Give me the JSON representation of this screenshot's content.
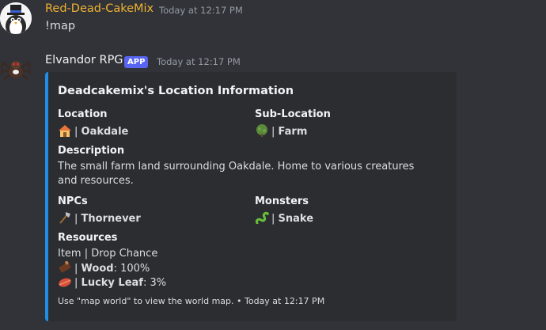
{
  "messages": [
    {
      "author": "Red-Dead-CakeMix",
      "author_color": "#f0b232",
      "timestamp": "Today at 12:17 PM",
      "text": "!map"
    },
    {
      "author": "Elvandor RPG",
      "author_color": "#f2f3f5",
      "badge": "APP",
      "timestamp": "Today at 12:17 PM"
    }
  ],
  "embed": {
    "accent_color": "#1e8ee6",
    "title": "Deadcakemix's Location Information",
    "location": {
      "name": "Location",
      "icon": "house-emoji",
      "separator": "|",
      "value": "Oakdale"
    },
    "sublocation": {
      "name": "Sub-Location",
      "icon": "tree-emoji",
      "separator": "|",
      "value": "Farm"
    },
    "description": {
      "name": "Description",
      "value": "The small farm land surrounding Oakdale. Home to various creatures and resources."
    },
    "npcs": {
      "name": "NPCs",
      "icon": "axe-emoji",
      "separator": "|",
      "value": "Thornever"
    },
    "monsters": {
      "name": "Monsters",
      "icon": "snake-emoji",
      "separator": "|",
      "value": "Snake"
    },
    "resources": {
      "name": "Resources",
      "header": "Item | Drop Chance",
      "items": [
        {
          "icon": "wood-emoji",
          "separator": "|",
          "name": "Wood",
          "chance": ": 100%"
        },
        {
          "icon": "leaf-emoji",
          "separator": "|",
          "name": "Lucky Leaf",
          "chance": ": 3%"
        }
      ]
    },
    "footer": "Use \"map world\" to view the world map. • Today at 12:17 PM"
  }
}
